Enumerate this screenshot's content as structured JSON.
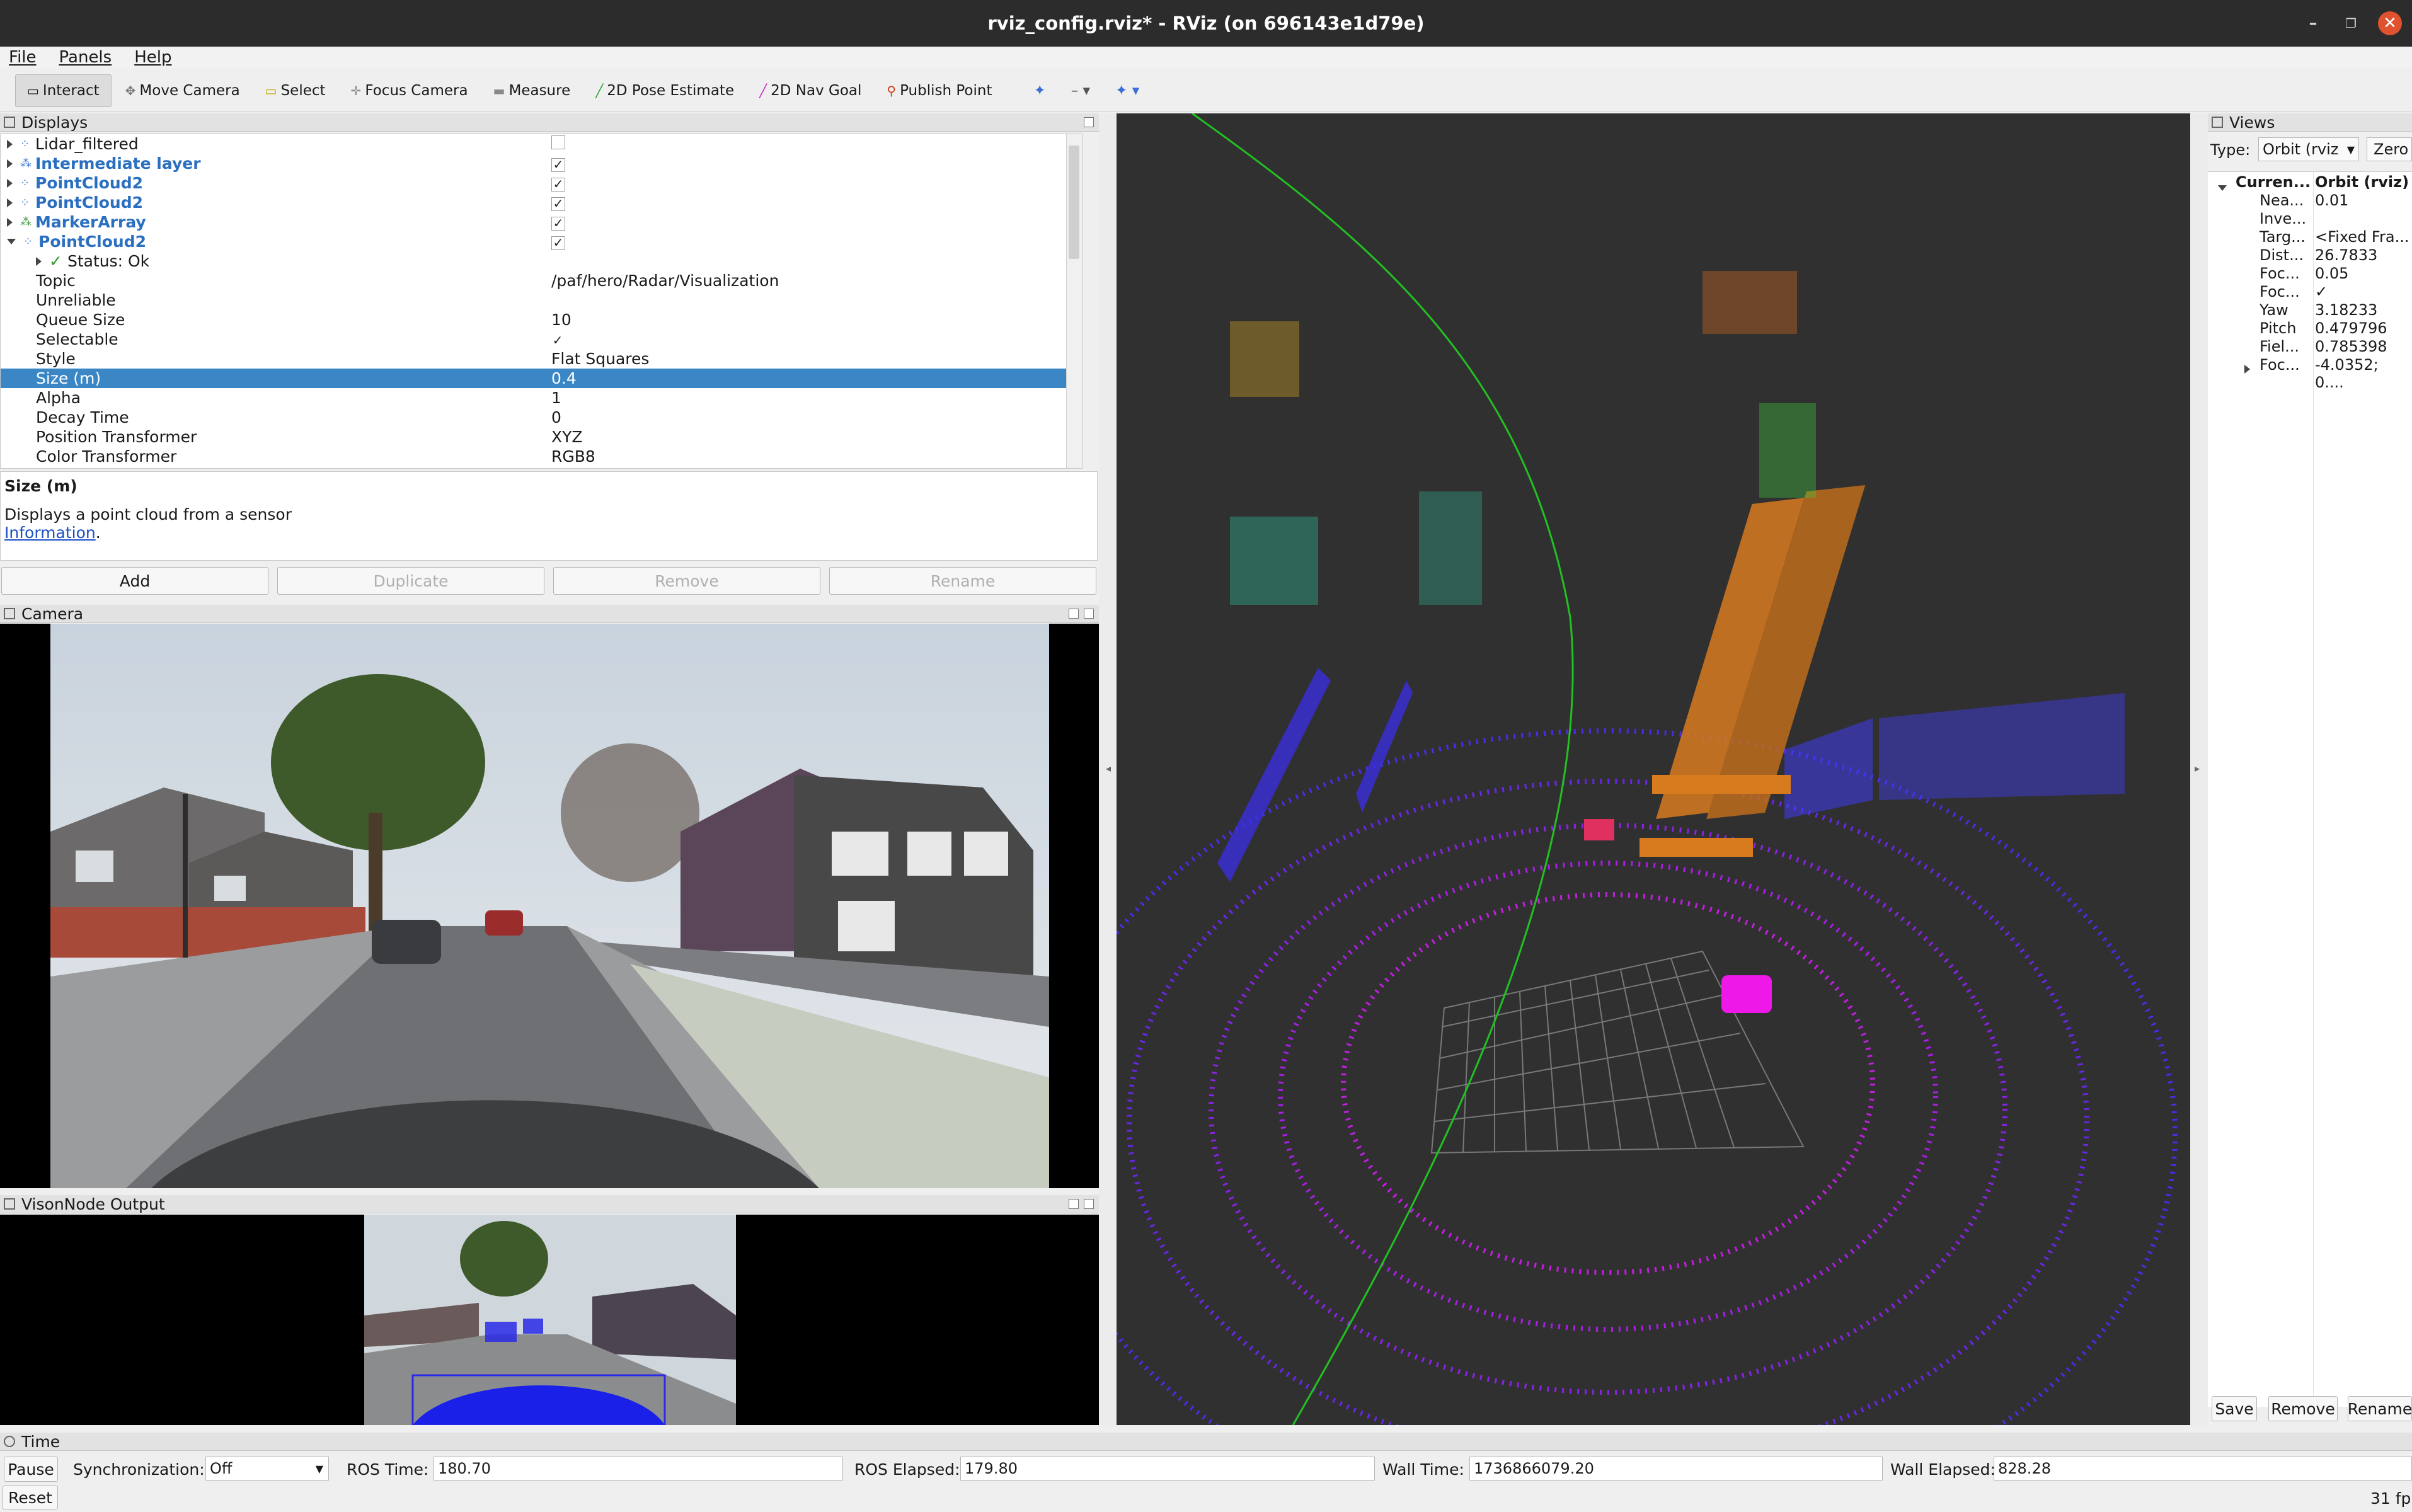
{
  "window": {
    "title": "rviz_config.rviz* - RViz (on 696143e1d79e)"
  },
  "menu": [
    "File",
    "Panels",
    "Help"
  ],
  "toolbar": [
    {
      "label": "Interact",
      "icon": "interact-icon",
      "active": true
    },
    {
      "label": "Move Camera",
      "icon": "move-camera-icon"
    },
    {
      "label": "Select",
      "icon": "select-icon"
    },
    {
      "label": "Focus Camera",
      "icon": "focus-camera-icon"
    },
    {
      "label": "Measure",
      "icon": "measure-icon"
    },
    {
      "label": "2D Pose Estimate",
      "icon": "pose-estimate-icon"
    },
    {
      "label": "2D Nav Goal",
      "icon": "nav-goal-icon"
    },
    {
      "label": "Publish Point",
      "icon": "publish-point-icon"
    }
  ],
  "displays": {
    "title": "Displays",
    "rows": [
      {
        "name": "Lidar_filtered",
        "value": "",
        "checkbox": "unchecked",
        "level": 0,
        "arrow": "right",
        "bold": false
      },
      {
        "name": "Intermediate layer",
        "value": "",
        "checkbox": "checked",
        "level": 0,
        "arrow": "right",
        "bold": true
      },
      {
        "name": "PointCloud2",
        "value": "",
        "checkbox": "checked",
        "level": 0,
        "arrow": "right",
        "bold": true
      },
      {
        "name": "PointCloud2",
        "value": "",
        "checkbox": "checked",
        "level": 0,
        "arrow": "right",
        "bold": true
      },
      {
        "name": "MarkerArray",
        "value": "",
        "checkbox": "checked",
        "level": 0,
        "arrow": "right",
        "bold": true
      },
      {
        "name": "PointCloud2",
        "value": "",
        "checkbox": "checked",
        "level": 0,
        "arrow": "down",
        "bold": true
      },
      {
        "name": "Status: Ok",
        "value": "",
        "level": 1,
        "arrow": "right",
        "status": true
      },
      {
        "name": "Topic",
        "value": "/paf/hero/Radar/Visualization",
        "level": 1
      },
      {
        "name": "Unreliable",
        "value": "",
        "checkbox": "unchecked-flat",
        "level": 1
      },
      {
        "name": "Queue Size",
        "value": "10",
        "level": 1
      },
      {
        "name": "Selectable",
        "value": "",
        "checkbox": "checked-flat",
        "level": 1
      },
      {
        "name": "Style",
        "value": "Flat Squares",
        "level": 1
      },
      {
        "name": "Size (m)",
        "value": "0.4",
        "level": 1,
        "selected": true
      },
      {
        "name": "Alpha",
        "value": "1",
        "level": 1
      },
      {
        "name": "Decay Time",
        "value": "0",
        "level": 1
      },
      {
        "name": "Position Transformer",
        "value": "XYZ",
        "level": 1
      },
      {
        "name": "Color Transformer",
        "value": "RGB8",
        "level": 1
      }
    ],
    "description_title": "Size (m)",
    "description_text": "Displays a point cloud from a sensor",
    "description_link": "Information",
    "buttons": [
      "Add",
      "Duplicate",
      "Remove",
      "Rename"
    ]
  },
  "camera_panel": {
    "title": "Camera"
  },
  "vision_panel": {
    "title": "VisonNode Output"
  },
  "views": {
    "title": "Views",
    "type_label": "Type:",
    "type_value": "Orbit (rviz",
    "zero_button": "Zero",
    "current_key": "Curren...",
    "current_value": "Orbit (rviz)",
    "rows": [
      {
        "key": "Nea...",
        "value": "0.01"
      },
      {
        "key": "Inve...",
        "value": ""
      },
      {
        "key": "Targ...",
        "value": "<Fixed Fra..."
      },
      {
        "key": "Dist...",
        "value": "26.7833"
      },
      {
        "key": "Foc...",
        "value": "0.05"
      },
      {
        "key": "Foc...",
        "value": "✓"
      },
      {
        "key": "Yaw",
        "value": "3.18233"
      },
      {
        "key": "Pitch",
        "value": "0.479796"
      },
      {
        "key": "Fiel...",
        "value": "0.785398"
      },
      {
        "key": "Foc...",
        "value": "-4.0352; 0...."
      }
    ],
    "buttons": [
      "Save",
      "Remove",
      "Rename"
    ]
  },
  "time": {
    "title": "Time",
    "pause": "Pause",
    "sync_label": "Synchronization:",
    "sync_value": "Off",
    "ros_time_label": "ROS Time:",
    "ros_time": "180.70",
    "ros_elapsed_label": "ROS Elapsed:",
    "ros_elapsed": "179.80",
    "wall_time_label": "Wall Time:",
    "wall_time": "1736866079.20",
    "wall_elapsed_label": "Wall Elapsed:",
    "wall_elapsed": "828.28",
    "reset": "Reset",
    "fps": "31 fp"
  },
  "colors": {
    "selection": "#3b87c6",
    "viewport_bg": "#303030",
    "lidar_near": "#c21ee0",
    "lidar_far": "#3a2ee8",
    "radar_box": "#d87a1e"
  }
}
